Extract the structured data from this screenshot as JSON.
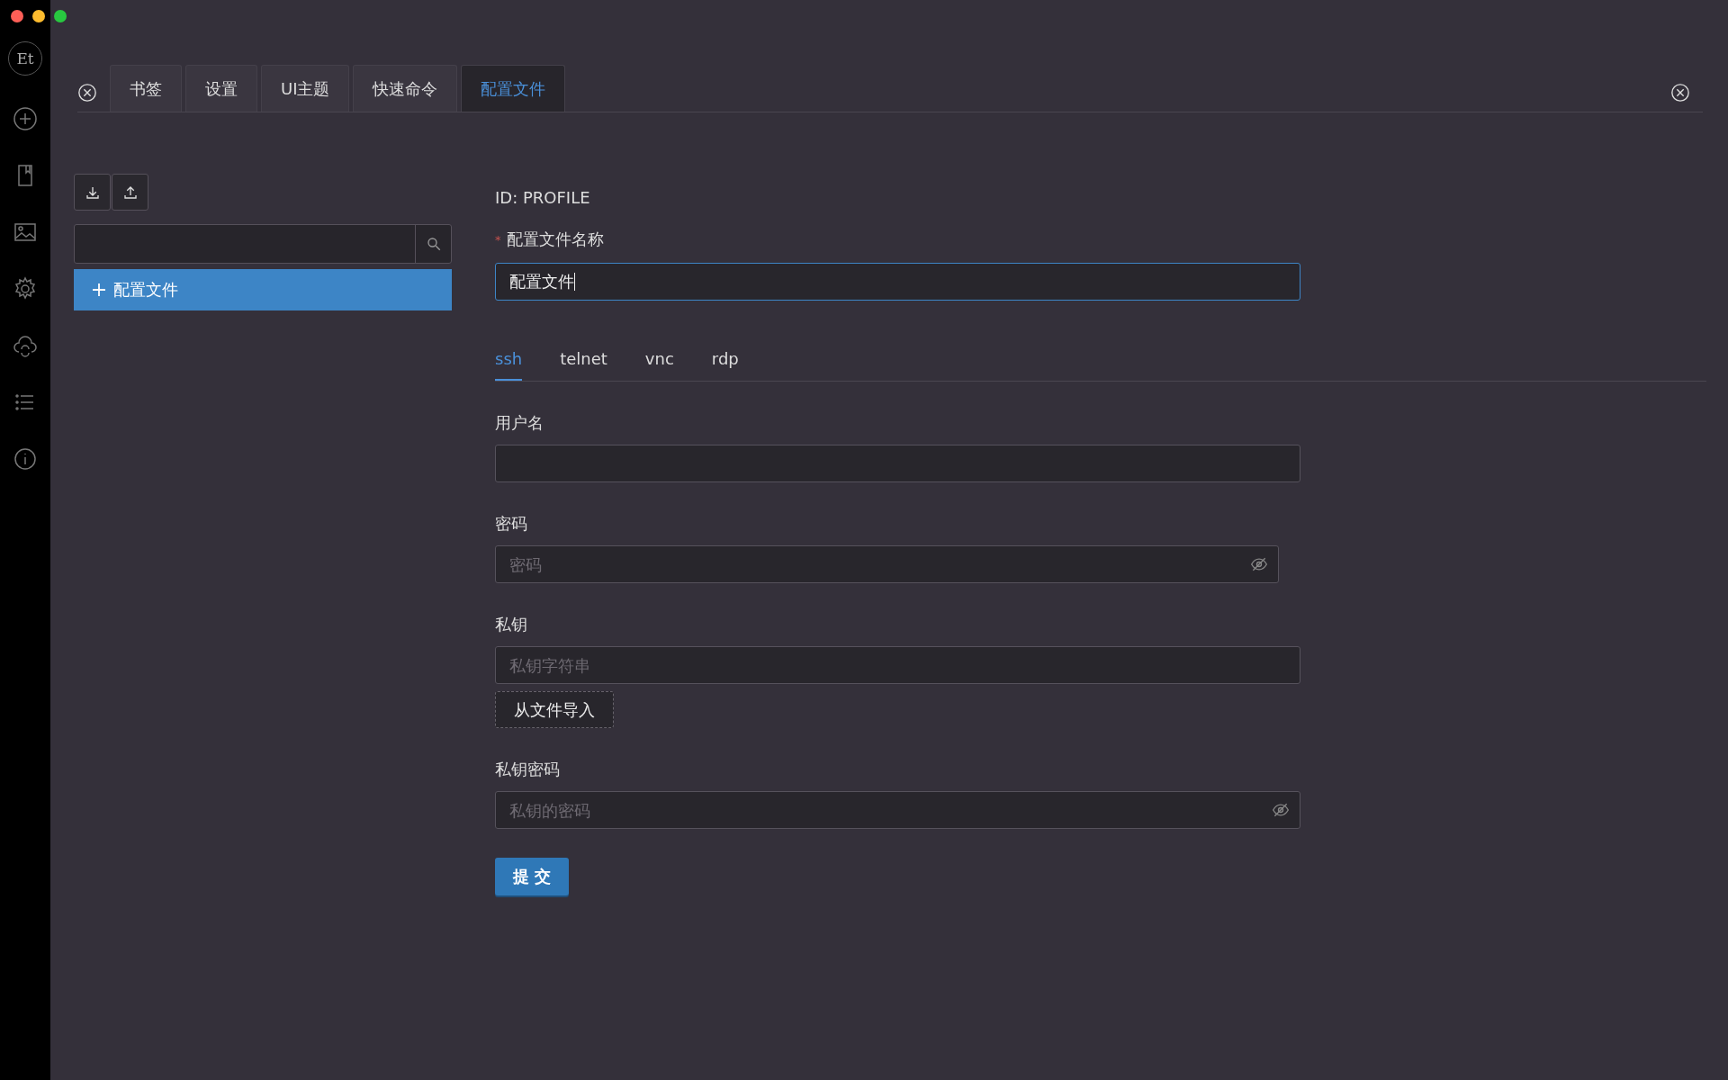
{
  "logo": "Et",
  "tabs": [
    {
      "label": "书签",
      "selected": false
    },
    {
      "label": "设置",
      "selected": false
    },
    {
      "label": "UI主题",
      "selected": false
    },
    {
      "label": "快速命令",
      "selected": false
    },
    {
      "label": "配置文件",
      "selected": true
    }
  ],
  "list_panel": {
    "items": [
      {
        "label": "配置文件",
        "selected": true
      }
    ]
  },
  "form": {
    "id_text": "ID: PROFILE",
    "name_field": {
      "required_mark": "*",
      "label": "配置文件名称",
      "value": "配置文件",
      "focused": true
    },
    "protocol_tabs": [
      {
        "label": "ssh",
        "selected": true
      },
      {
        "label": "telnet",
        "selected": false
      },
      {
        "label": "vnc",
        "selected": false
      },
      {
        "label": "rdp",
        "selected": false
      }
    ],
    "fields": [
      {
        "kind": "text",
        "label": "用户名"
      },
      {
        "kind": "password",
        "label": "密码",
        "placeholder": "密码"
      },
      {
        "kind": "key",
        "label": "私钥",
        "placeholder": "私钥字符串",
        "button": "从文件导入"
      },
      {
        "kind": "password",
        "label": "私钥密码",
        "placeholder": "私钥的密码"
      }
    ],
    "submit": "提 交"
  }
}
